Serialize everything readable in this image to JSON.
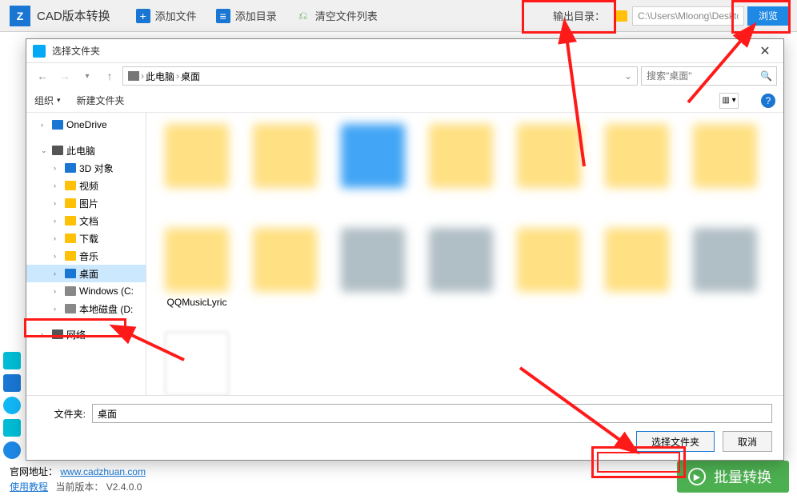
{
  "app": {
    "title": "CAD版本转换",
    "toolbar": {
      "add_file": "添加文件",
      "add_dir": "添加目录",
      "clear_list": "清空文件列表",
      "output_label": "输出目录：",
      "output_path": "C:\\Users\\Mloong\\Desktop",
      "browse": "浏览"
    },
    "bottom": {
      "site_label": "官网地址：",
      "site_url": "www.cadzhuan.com",
      "tutorial": "使用教程",
      "version_label": "当前版本：",
      "version": "V2.4.0.0",
      "batch": "批量转换"
    }
  },
  "dialog": {
    "title": "选择文件夹",
    "breadcrumb": {
      "a": "此电脑",
      "b": "桌面"
    },
    "search_placeholder": "搜索\"桌面\"",
    "organize": "组织",
    "new_folder": "新建文件夹",
    "tree": {
      "onedrive": "OneDrive",
      "this_pc": "此电脑",
      "obj3d": "3D 对象",
      "video": "视频",
      "pictures": "图片",
      "documents": "文档",
      "downloads": "下载",
      "music": "音乐",
      "desktop": "桌面",
      "win_c": "Windows (C:",
      "disk_d": "本地磁盘 (D:",
      "network": "网络"
    },
    "grid": {
      "qqmusic": "QQMusicLyric"
    },
    "folder_label": "文件夹:",
    "folder_value": "桌面",
    "select_btn": "选择文件夹",
    "cancel_btn": "取消"
  }
}
